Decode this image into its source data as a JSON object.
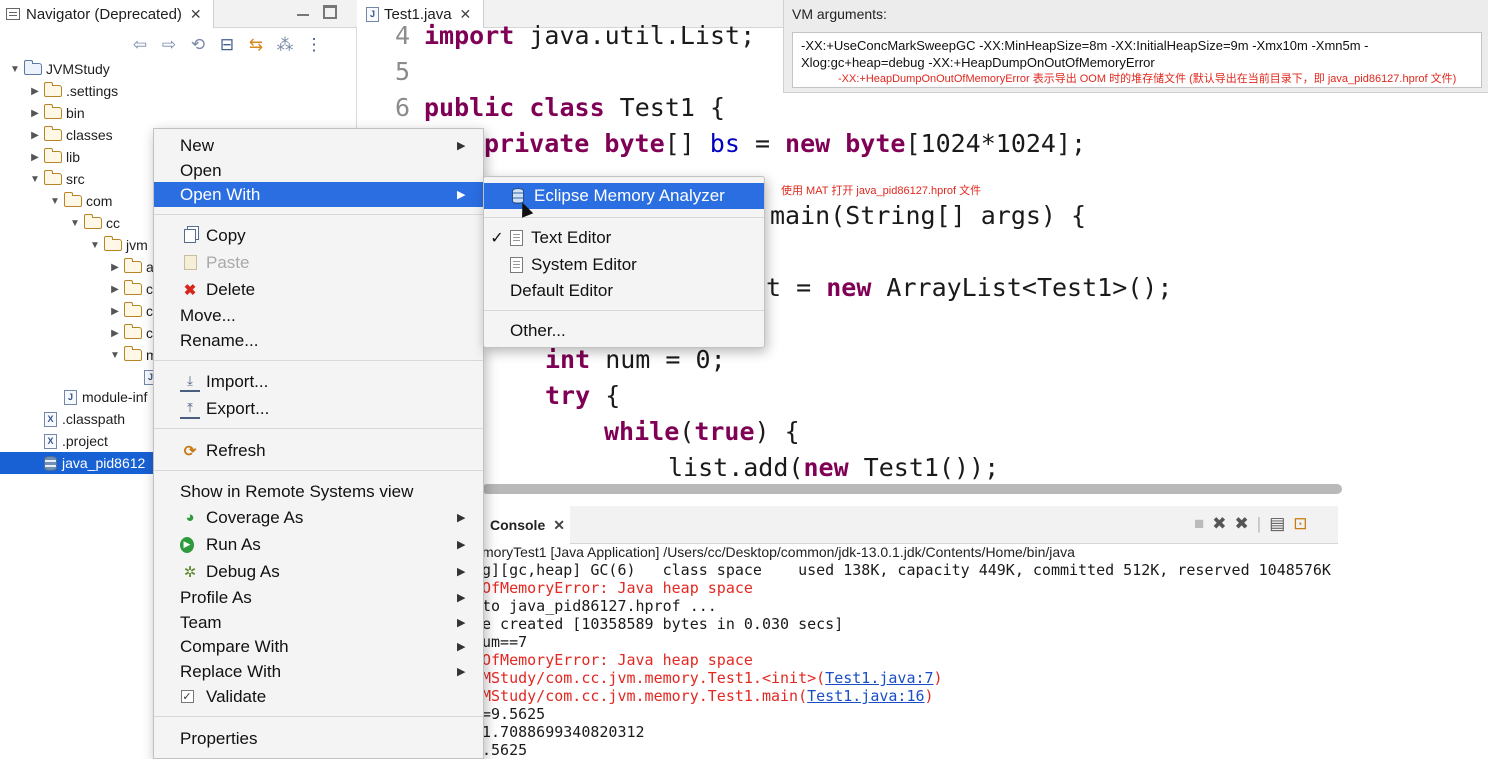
{
  "navigator": {
    "title": "Navigator (Deprecated)",
    "tree": [
      {
        "label": "JVMStudy",
        "kind": "project",
        "open": true
      },
      {
        "label": ".settings",
        "kind": "folder"
      },
      {
        "label": "bin",
        "kind": "folder"
      },
      {
        "label": "classes",
        "kind": "folder"
      },
      {
        "label": "lib",
        "kind": "folder"
      },
      {
        "label": "src",
        "kind": "folder",
        "open": true
      },
      {
        "label": "com",
        "kind": "folder",
        "open": true
      },
      {
        "label": "cc",
        "kind": "folder",
        "open": true
      },
      {
        "label": "jvm",
        "kind": "folder",
        "open": true
      },
      {
        "label": "a",
        "kind": "folder"
      },
      {
        "label": "c",
        "kind": "folder"
      },
      {
        "label": "c",
        "kind": "folder"
      },
      {
        "label": "c",
        "kind": "folder"
      },
      {
        "label": "m",
        "kind": "folder",
        "open": true
      },
      {
        "label": "module-inf",
        "kind": "java"
      },
      {
        "label": ".classpath",
        "kind": "xml"
      },
      {
        "label": ".project",
        "kind": "xml"
      },
      {
        "label": "java_pid8612",
        "kind": "heap",
        "selected": true
      }
    ]
  },
  "editor": {
    "tab_title": "Test1.java",
    "lines": {
      "l4_num": "4",
      "l4_kw": "import",
      "l4_rest": " java.util.List;",
      "l5_num": "5",
      "l6_num": "6",
      "l6_kw1": "public",
      "l6_kw2": " class",
      "l6_rest": " Test1 {",
      "l7_kw": "private",
      "l7_kw2": " byte",
      "l7_mid": "[] ",
      "l7_fld": "bs",
      "l7_eq": " = ",
      "l7_kw3": "new",
      "l7_kw4": " byte",
      "l7_rest": "[1024*1024];",
      "l9_rest": "main(String[] args) {",
      "l11_rest": "t = ",
      "l11_kw": "new",
      "l11_rest2": " ArrayList<Test1>();",
      "l13_kw": "int",
      "l13_rest": " num = 0;",
      "l14_kw": "try",
      "l14_rest": " {",
      "l15_kw": "while",
      "l15_mid": "(",
      "l15_kw2": "true",
      "l15_rest": ") {",
      "l16_a": "list.add(",
      "l16_kw": "new",
      "l16_b": " Test1());"
    }
  },
  "vm_arguments": {
    "label": "VM arguments:",
    "line1": "-XX:+UseConcMarkSweepGC  -XX:MinHeapSize=8m -XX:InitialHeapSize=9m -Xmx10m -Xmn5m -",
    "line2": "Xlog:gc+heap=debug -XX:+HeapDumpOnOutOfMemoryError",
    "note": "-XX:+HeapDumpOnOutOfMemoryError 表示导出 OOM 时的堆存储文件 (默认导出在当前目录下，即 java_pid86127.hprof 文件)"
  },
  "console": {
    "tab_title": "Console",
    "header": "moryTest1 [Java Application] /Users/cc/Desktop/common/jdk-13.0.1.jdk/Contents/Home/bin/java",
    "lines": {
      "c1": "g][gc,heap] GC(6)   class space    used 138K, capacity 449K, committed 512K, reserved 1048576K",
      "c2": "OfMemoryError: Java heap space",
      "c3": "to java_pid86127.hprof ...",
      "c4": "e created [10358589 bytes in 0.030 secs]",
      "c5": "um==7",
      "c6": "OfMemoryError: Java heap space",
      "c7a": "MStudy/com.cc.jvm.memory.Test1.<init>(",
      "c7link": "Test1.java:7",
      "c7b": ")",
      "c8a": "MStudy/com.cc.jvm.memory.Test1.main(",
      "c8link": "Test1.java:16",
      "c8b": ")",
      "c9": "=9.5625",
      "c10": "1.7088699340820312",
      "c11": ".5625"
    }
  },
  "context_menu": {
    "new": "New",
    "open": "Open",
    "open_with": "Open With",
    "copy": "Copy",
    "paste": "Paste",
    "delete": "Delete",
    "move": "Move...",
    "rename": "Rename...",
    "import": "Import...",
    "export": "Export...",
    "refresh": "Refresh",
    "show_remote": "Show in Remote Systems view",
    "coverage_as": "Coverage As",
    "run_as": "Run As",
    "debug_as": "Debug As",
    "profile_as": "Profile As",
    "team": "Team",
    "compare_with": "Compare With",
    "replace_with": "Replace With",
    "validate": "Validate",
    "properties": "Properties"
  },
  "open_with_submenu": {
    "mat": "Eclipse Memory Analyzer",
    "text_editor": "Text Editor",
    "system_editor": "System Editor",
    "default_editor": "Default Editor",
    "other": "Other...",
    "note": "使用 MAT 打开 java_pid86127.hprof 文件"
  }
}
